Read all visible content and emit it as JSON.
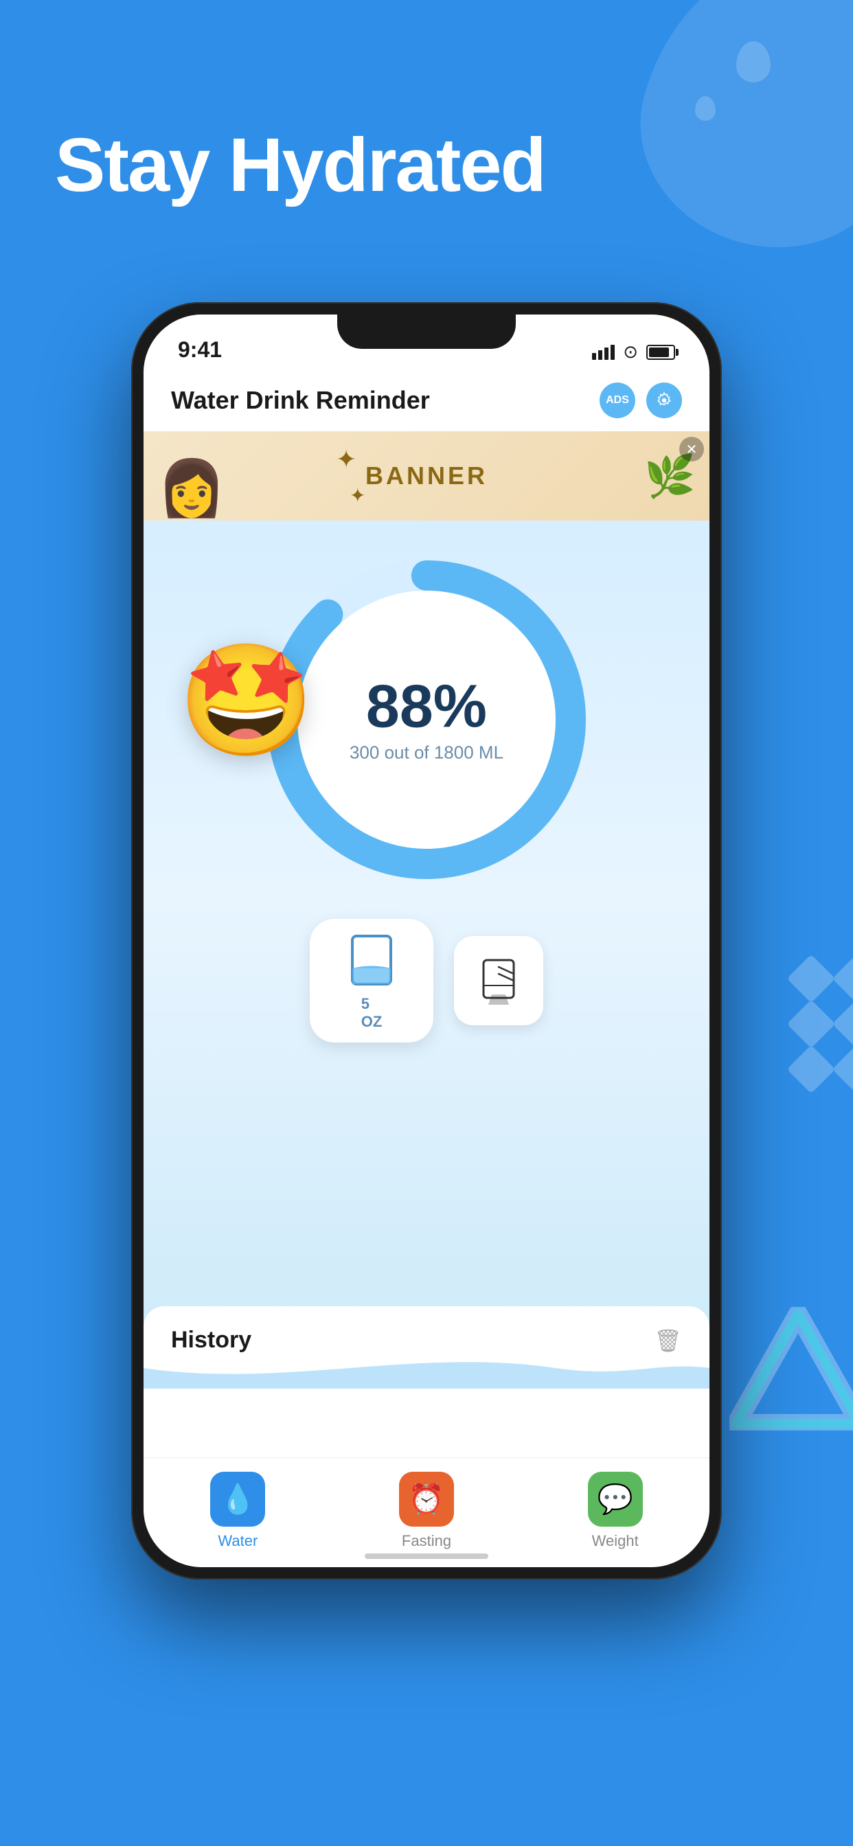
{
  "background_color": "#2E8EE8",
  "hero": {
    "title": "Stay Hydrated",
    "decorative_drops": [
      "large",
      "small1",
      "small2"
    ]
  },
  "phone": {
    "status_bar": {
      "time": "9:41",
      "signal_bars": 4,
      "wifi": true,
      "battery_percent": 85
    },
    "app_header": {
      "title": "Water Drink Reminder",
      "ads_button_label": "ADS",
      "settings_icon": "gear-icon"
    },
    "banner": {
      "text": "BANNER",
      "close_icon": "close-icon"
    },
    "progress": {
      "percent": "88%",
      "detail": "300 out of 1800 ML",
      "value": 88,
      "color": "#5BB8F5"
    },
    "mascot_emoji": "🤩",
    "water_buttons": {
      "primary": {
        "icon": "🥛",
        "label": "5\nOZ"
      },
      "secondary": {
        "icon": "📋"
      }
    },
    "history": {
      "title": "History",
      "delete_icon": "trash-icon"
    },
    "tab_bar": {
      "items": [
        {
          "label": "Water",
          "icon": "💧",
          "bg": "#2E8EE8",
          "active": true
        },
        {
          "label": "Fasting",
          "icon": "⏰",
          "bg": "#E8642E",
          "active": false
        },
        {
          "label": "Weight",
          "icon": "💬",
          "bg": "#5CB85C",
          "active": false
        }
      ]
    }
  }
}
